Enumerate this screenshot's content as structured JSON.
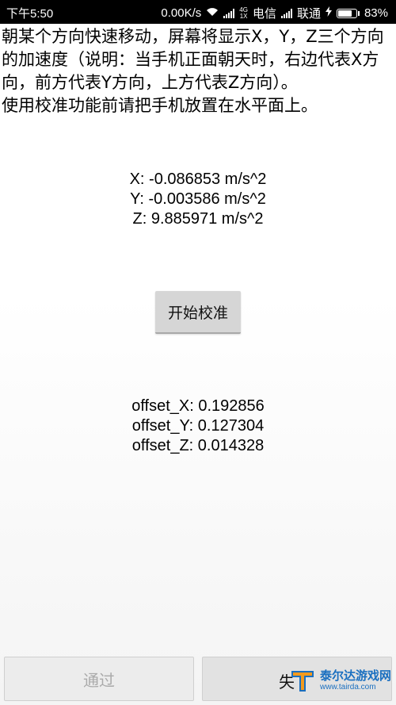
{
  "status_bar": {
    "time": "下午5:50",
    "speed": "0.00K/s",
    "network_type_top": "4G",
    "network_type_bottom": "1X",
    "carrier1": "电信",
    "carrier2": "联通",
    "battery_percent": "83%",
    "battery_level": 0.83
  },
  "instructions": "朝某个方向快速移动，屏幕将显示X，Y，Z三个方向的加速度（说明：当手机正面朝天时，右边代表X方向，前方代表Y方向，上方代表Z方向）。使用校准功能前请把手机放置在水平面上。",
  "instructions_lines": [
    "朝某个方向快速移动，屏幕将显示X，Y，Z三个方向",
    "的加速度（说明：当手机正面朝天时，右边代表X方",
    "向，前方代表Y方向，上方代表Z方向）。",
    "使用校准功能前请把手机放置在水平面上。"
  ],
  "acceleration": {
    "x": "X: -0.086853 m/s^2",
    "y": "Y: -0.003586 m/s^2",
    "z": "Z: 9.885971 m/s^2"
  },
  "calibrate_button": "开始校准",
  "offsets": {
    "x": "offset_X: 0.192856",
    "y": "offset_Y: 0.127304",
    "z": "offset_Z: 0.014328"
  },
  "buttons": {
    "pass": "通过",
    "fail": "失"
  },
  "watermark": {
    "title": "泰尔达游戏网",
    "url": "www.tairda.com"
  },
  "colors": {
    "watermark_blue": "#1a6fc0",
    "watermark_orange": "#f39a1e"
  }
}
